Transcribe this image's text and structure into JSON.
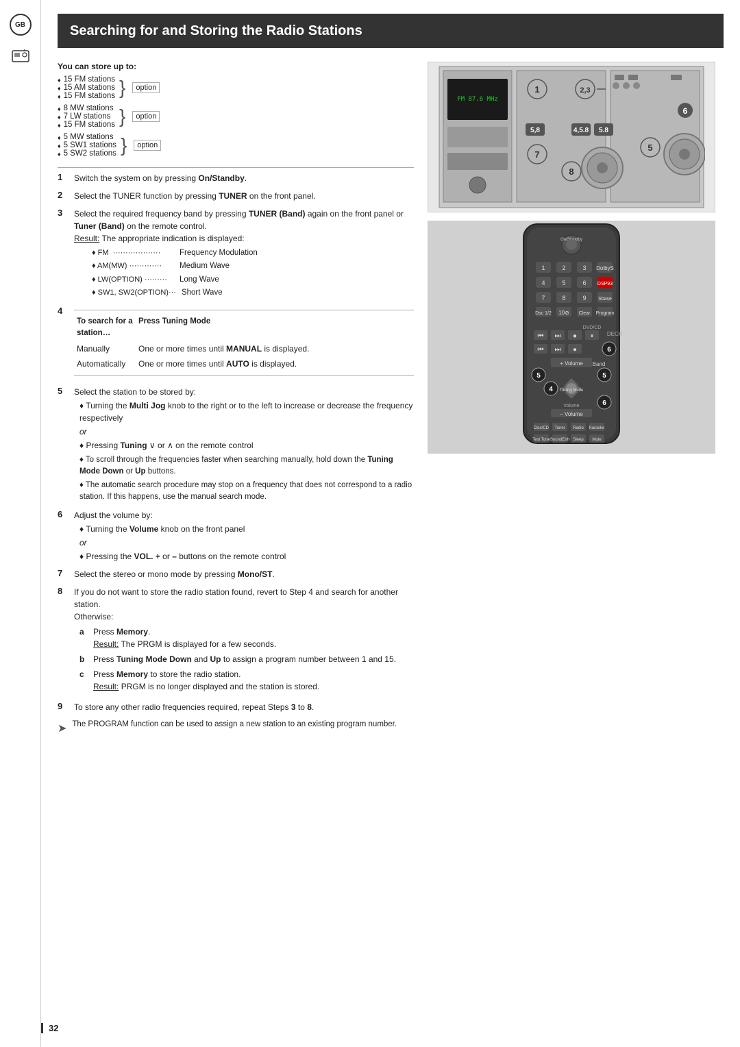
{
  "page": {
    "number": "32",
    "title": "Searching for and Storing the Radio Stations"
  },
  "sidebar": {
    "gb_label": "GB"
  },
  "store_info": {
    "title": "You can store up to:",
    "groups": [
      {
        "items": [
          "15 FM stations",
          "15 AM stations",
          "15 FM stations"
        ],
        "option": "option"
      },
      {
        "items": [
          "8 MW stations",
          "7 LW stations",
          "15 FM stations"
        ],
        "option": "option"
      },
      {
        "items": [
          "5 MW stations",
          "5 SW1 stations",
          "5 SW2 stations"
        ],
        "option": "option"
      }
    ]
  },
  "steps": [
    {
      "num": "1",
      "text": "Switch the system on by pressing ",
      "bold": "On/Standby",
      "rest": "."
    },
    {
      "num": "2",
      "text": "Select the TUNER function by pressing ",
      "bold": "TUNER",
      "rest": " on the front panel."
    },
    {
      "num": "3",
      "text": "Select the required frequency band by pressing ",
      "bold_inline": "TUNER (Band)",
      "rest": " again on the front panel or ",
      "bold2": "Tuner (Band)",
      "rest2": " on the remote control.",
      "result_label": "Result:",
      "result_text": " The appropriate indication is displayed:",
      "dots": [
        {
          "key": "♦ FM",
          "dots": true,
          "val": "Frequency Modulation"
        },
        {
          "key": "♦ AM(MW)",
          "dots": true,
          "val": "Medium Wave"
        },
        {
          "key": "♦ LW(OPTION)",
          "dots": true,
          "val": "Long Wave"
        },
        {
          "key": "♦ SW1, SW2(OPTION)",
          "dots": true,
          "val": "Short Wave"
        }
      ]
    },
    {
      "num": "4",
      "header_col1": "To search for a",
      "header_col2": "Press Tuning Mode",
      "header_sub": "station…",
      "rows": [
        {
          "col1": "Manually",
          "col2": "",
          "col3": "One or more times until MANUAL is displayed."
        },
        {
          "col1": "Automatically",
          "col2": "",
          "col3": "One or more times until AUTO is displayed."
        }
      ]
    },
    {
      "num": "5",
      "intro": "Select the station to be stored by:",
      "bullets": [
        "Turning the Multi Jog knob to the right or to the left to increase or decrease the frequency respectively",
        "or",
        "Pressing Tuning ∨ or ∧ on the remote control",
        "",
        "♦ To scroll through the frequencies faster when searching manually, hold down the Tuning Mode Down or Up buttons.",
        "♦ The automatic search procedure may stop on a frequency that does not correspond to a radio station. If this happens, use the manual search mode."
      ]
    },
    {
      "num": "6",
      "intro": "Adjust the volume by:",
      "bullets": [
        "♦ Turning the Volume knob on the front panel",
        "or",
        "♦ Pressing the VOL. + or – buttons on the remote control"
      ]
    },
    {
      "num": "7",
      "text": "Select the stereo or mono mode by pressing ",
      "bold": "Mono/ST",
      "rest": "."
    },
    {
      "num": "8",
      "text": "If you do not want to store the radio station found, revert to Step 4 and search for another station.",
      "otherwise": "Otherwise:",
      "sub_steps": [
        {
          "letter": "a",
          "text": "Press ",
          "bold": "Memory",
          "rest": ".",
          "result_label": "Result:",
          "result_text": " The PRGM is displayed for a few seconds."
        },
        {
          "letter": "b",
          "text": "Press ",
          "bold": "Tuning Mode Down",
          "rest": " and ",
          "bold2": "Up",
          "rest2": " to assign a program number between 1 and 15."
        },
        {
          "letter": "c",
          "text": "Press ",
          "bold": "Memory",
          "rest": " to store the radio station.",
          "result_label": "Result:",
          "result_text": " PRGM is no longer displayed and the station is stored."
        }
      ]
    },
    {
      "num": "9",
      "text": "To store any other radio frequencies required, repeat Steps 3 to 8."
    }
  ],
  "note": {
    "icon": "➤",
    "text": "The PROGRAM function can be used to assign a new station to an existing program number."
  }
}
